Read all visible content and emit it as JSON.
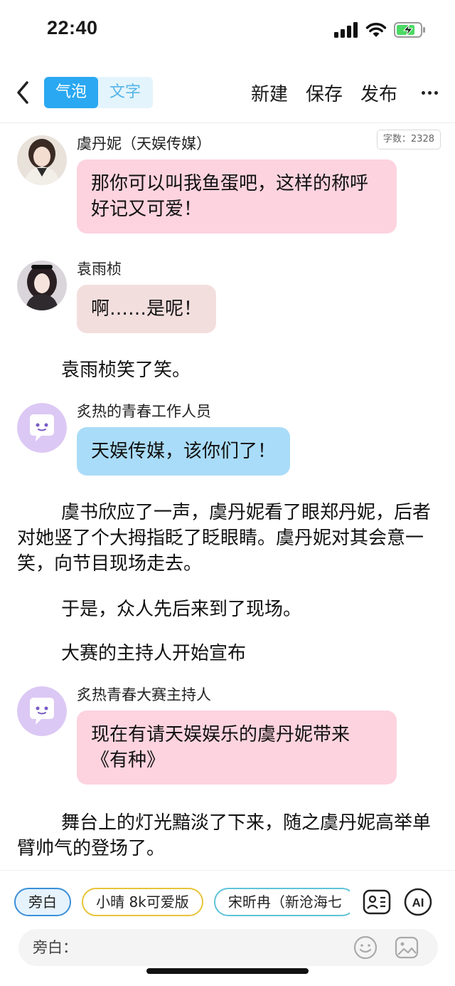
{
  "status_bar": {
    "time": "22:40"
  },
  "nav": {
    "modes": [
      "气泡",
      "文字"
    ],
    "active_mode": "气泡",
    "actions": [
      "新建",
      "保存",
      "发布"
    ]
  },
  "word_count": "字数：2328",
  "messages": [
    {
      "sender": "虞丹妮（天娱传媒）",
      "text": "那你可以叫我鱼蛋吧，这样的称呼好记又可爱！",
      "bubble_color": "#fdd3df",
      "avatar": "photo-avatar-1"
    },
    {
      "sender": "袁雨桢",
      "text": "啊……是呢！",
      "bubble_color": "#f3dede",
      "avatar": "photo-avatar-2"
    },
    {
      "sender": "炙热的青春工作人员",
      "text": "天娱传媒，该你们了！",
      "bubble_color": "#a9dcf8",
      "avatar": "bubble-face-icon"
    },
    {
      "sender": "炙热青春大赛主持人",
      "text": "现在有请天娱娱乐的虞丹妮带来《有种》",
      "bubble_color": "#fdd3df",
      "avatar": "bubble-face-icon"
    }
  ],
  "narrations": [
    "袁雨桢笑了笑。",
    "虞书欣应了一声，虞丹妮看了眼郑丹妮，后者对她竖了个大拇指眨了眨眼睛。虞丹妮对其会意一笑，向节目现场走去。",
    "于是，众人先后来到了现场。",
    "大赛的主持人开始宣布",
    "舞台上的灯光黯淡了下来，随之虞丹妮高举单臂帅气的登场了。"
  ],
  "bottom": {
    "chips": [
      "旁白",
      "小晴 8k可爱版",
      "宋昕冉（新沧海七"
    ],
    "input_placeholder": "旁白："
  },
  "colors": {
    "accent": "#2aa8f2",
    "pink_bubble": "#fdd3df",
    "blue_bubble": "#a9dcf8"
  }
}
